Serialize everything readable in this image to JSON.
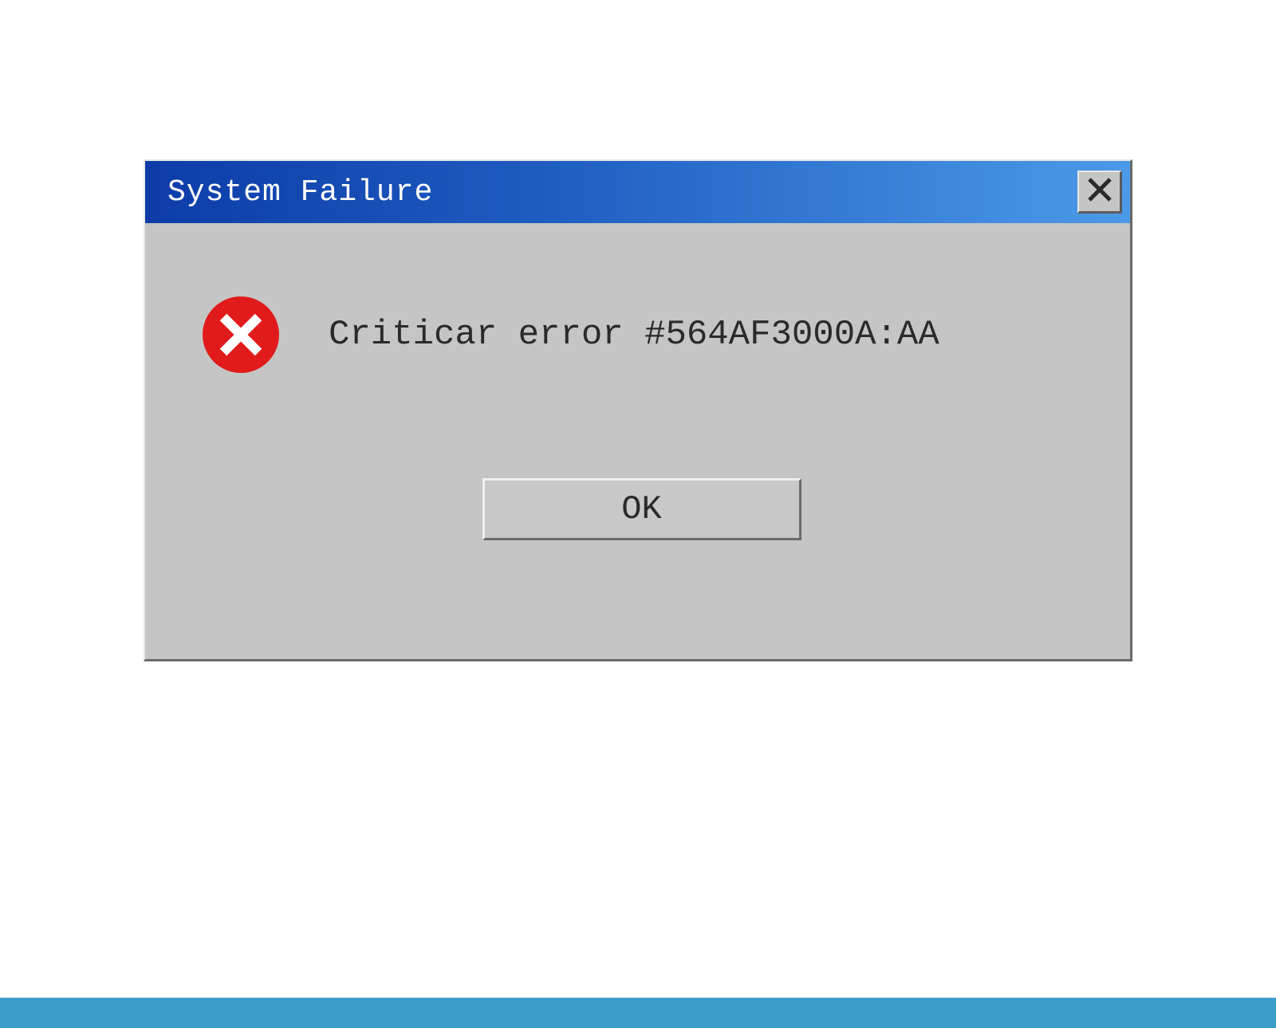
{
  "dialog": {
    "title": "System Failure",
    "message": "Criticar error #564AF3000A:AA",
    "ok_label": "OK"
  },
  "colors": {
    "titlebar_gradient_start": "#0d3ca8",
    "titlebar_gradient_end": "#4b9ae8",
    "dialog_bg": "#c5c5c5",
    "error_icon": "#e11b1b",
    "footer": "#3b9dcc"
  }
}
